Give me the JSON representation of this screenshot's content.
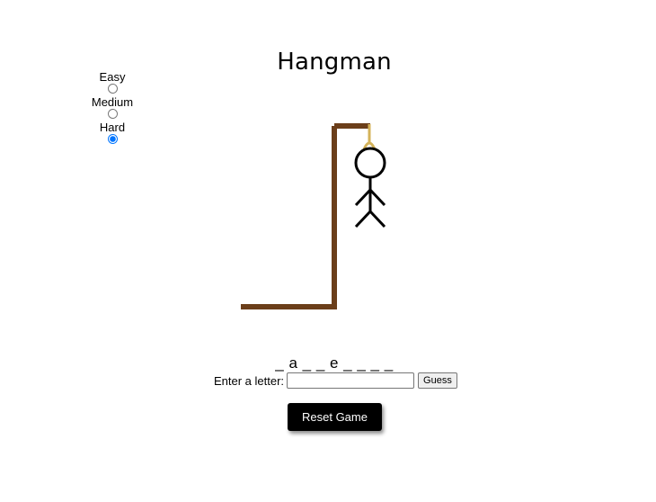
{
  "title": "Hangman",
  "difficulty": {
    "options": [
      {
        "label": "Easy",
        "selected": false
      },
      {
        "label": "Medium",
        "selected": false
      },
      {
        "label": "Hard",
        "selected": true
      }
    ]
  },
  "word_display": "_ a _ _ e _ _ _ _",
  "guess": {
    "label": "Enter a letter:",
    "value": "",
    "placeholder": "",
    "button_label": "Guess"
  },
  "reset_label": "Reset Game",
  "colors": {
    "gallows": "#6b3e1a",
    "rope": "#d4b35a",
    "figure": "#000000",
    "reset_bg": "#000000"
  }
}
